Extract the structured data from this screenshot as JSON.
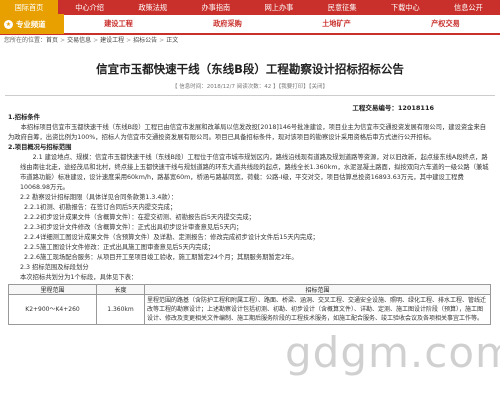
{
  "nav": {
    "items": [
      {
        "label": "国际首页",
        "name": "nav-home"
      },
      {
        "label": "中心介绍",
        "name": "nav-intro"
      },
      {
        "label": "政策法规",
        "name": "nav-policy"
      },
      {
        "label": "办事指南",
        "name": "nav-guide"
      },
      {
        "label": "网上办事",
        "name": "nav-online"
      },
      {
        "label": "民意征集",
        "name": "nav-opinion"
      },
      {
        "label": "下载中心",
        "name": "nav-download"
      },
      {
        "label": "信息公开",
        "name": "nav-public"
      }
    ]
  },
  "subnav": {
    "channel": "专业频道",
    "items": [
      "建设工程",
      "政府采购",
      "土地矿产",
      "产权交易"
    ]
  },
  "breadcrumb": {
    "prefix": "您所在的位置：",
    "items": [
      "首页",
      "交易信息",
      "建设工程",
      "招标公告",
      "正文"
    ]
  },
  "article": {
    "title": "信宜市玉都快速干线（东线B段）工程勘察设计招标招标公告",
    "meta": "【 信息时间：2018/12/7   阅读次数：42 】【我要打印】【关闭】",
    "code_line": "工程交易编号：12018116",
    "lines": [
      {
        "t": "1.招标条件",
        "k": "h"
      },
      {
        "t": "本招标项目信宜市玉都快速干线（东线B段）工程已由信宜市发展和改革局以信发改投[2018]146号批准建设，项目业主为信宜市交通投资发展有限公司，建设资金来自为政府自筹，出资比例为100%，招标人为信宜市交通投资发展有限公司。项目已具备招标条件，现对该项目的勘察设计采用资格后审方式进行公开招标。",
        "k": "p"
      },
      {
        "t": "2.项目概况与招标范围",
        "k": "h"
      },
      {
        "t": "2.1 建设地点、规模：信宜市玉都快速干线（东线B段）工程位于信宜市城市规划区内，路线沿线现有道路及规划道路等资源，对以旧改新，起点接东线A段终点，路线由南往北走，途经茂瓜和北村，终点接上玉都快速干线与规划道路的环东大道共线段的起点，路线全长1.360km，水泥混凝土路面，拟按双向六车道的一级公路（兼城市道路功能）标准建设，设计速度采用60km/h，路基宽60m，桥涵与路基同宽，荷载：公路-I级，平交对交，项目估算总投资16893.63万元，其中建设工程费10068.98万元。",
        "k": "ind"
      },
      {
        "t": "2.2 勘察设计招标期限（具体详见合同条款第1.3.4款）：",
        "k": "ind"
      },
      {
        "t": "2.2.1初测、初勘报告：在签订合同后5天内提交完成；",
        "k": "ind2"
      },
      {
        "t": "2.2.2初步设计成果文件（含概算文件）：在提交初测、初勘报告后5天内提交完成；",
        "k": "ind2"
      },
      {
        "t": "2.2.3初步设计文件修改（含概算文件）：正式出具初步设计审查意见后5天内；",
        "k": "ind2"
      },
      {
        "t": "2.2.4详细测工图设计成果文件（含预算文件）及详勘、定测报告：修改完成初步设计文件后15天内完成；",
        "k": "ind2"
      },
      {
        "t": "2.2.5施工图设计文件修改：正式出具施工图审查意见后5天内完成；",
        "k": "ind2"
      },
      {
        "t": "2.2.6施工现场配合服务：从项目开工至项目竣工验收，施工期暂定24个月；其期服务期暂定2年。",
        "k": "ind2"
      },
      {
        "t": "2.3 招标范围及标段划分",
        "k": "ind"
      },
      {
        "t": "本次招标共划分为1个标段，具体见下表：",
        "k": "ind"
      }
    ]
  },
  "table": {
    "headers": [
      "里程范围",
      "长度",
      "招标范围"
    ],
    "rows": [
      {
        "range": "K2+900～K4+260",
        "length": "1.360km",
        "scope": "里程范围的路基（含防护工程和附属工程）、路面、桥梁、涵洞、交叉工程、交通安全设施、照明、绿化工程、排水工程、管线迁改等工程的勘察设计；上述勘察设计包括初测、初勘、初步设计（含概算文件）、详勘、定测、施工图设计阶段（预算），施工图设计、修改及变更相关文件编制、施工期后服务阶段的工程技术服务，如施工配合服务、竣工验收会议及各项相关事宜工作等。"
      }
    ]
  },
  "watermark": {
    "main": "gdgm.com",
    "sub": "cn"
  }
}
